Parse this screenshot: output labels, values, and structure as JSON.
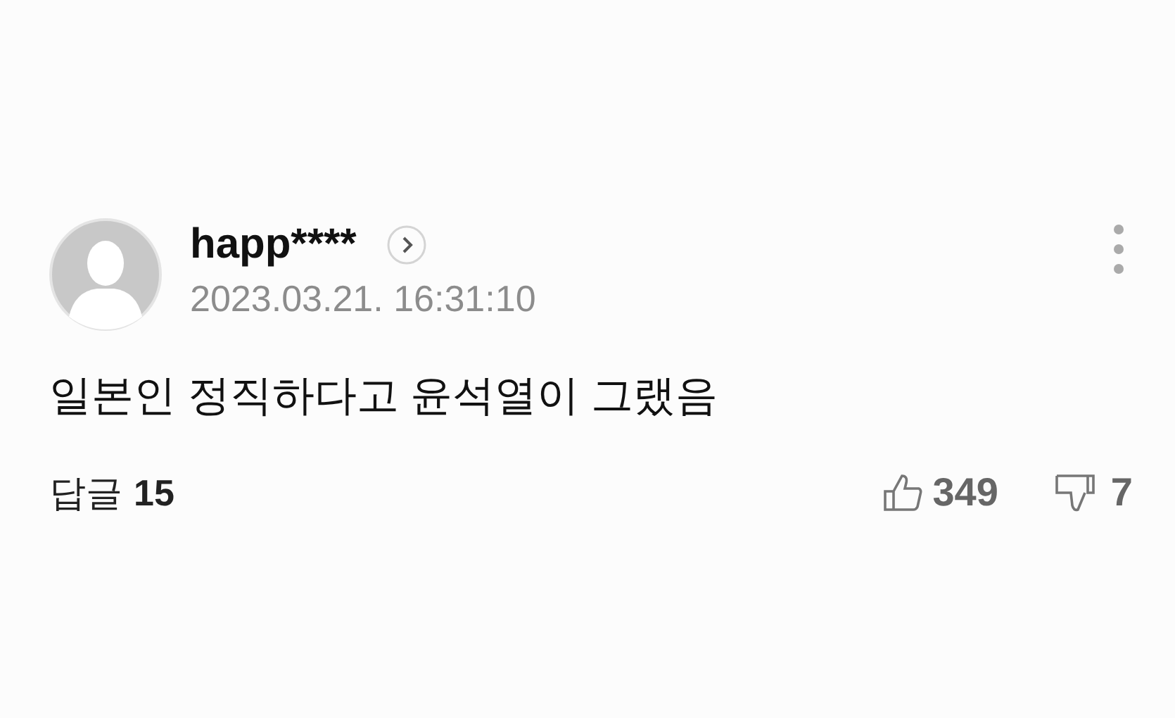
{
  "comment": {
    "author": "happ****",
    "date": "2023.03.21. 16:31:10",
    "body": "일본인 정직하다고 윤석열이 그랬음",
    "replies_label": "답글",
    "replies_count": "15",
    "likes": "349",
    "dislikes": "7"
  }
}
